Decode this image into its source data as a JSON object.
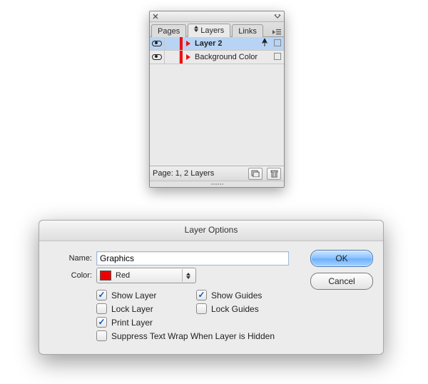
{
  "panel": {
    "tabs": [
      "Pages",
      "Layers",
      "Links"
    ],
    "active_tab": 1,
    "layers": [
      {
        "name": "Layer 2",
        "color": "#ee1111",
        "selected": true,
        "has_pen": true
      },
      {
        "name": "Background Color",
        "color": "#ee1111",
        "selected": false,
        "has_pen": false
      }
    ],
    "footer_status": "Page: 1, 2 Layers"
  },
  "dialog": {
    "title": "Layer Options",
    "name_label": "Name:",
    "name_value": "Graphics",
    "color_label": "Color:",
    "color_value": "Red",
    "color_swatch": "#ee0000",
    "checks": {
      "show_layer": {
        "label": "Show Layer",
        "checked": true
      },
      "lock_layer": {
        "label": "Lock Layer",
        "checked": false
      },
      "print_layer": {
        "label": "Print Layer",
        "checked": true
      },
      "show_guides": {
        "label": "Show Guides",
        "checked": true
      },
      "lock_guides": {
        "label": "Lock Guides",
        "checked": false
      },
      "suppress": {
        "label": "Suppress Text Wrap When Layer is Hidden",
        "checked": false
      }
    },
    "buttons": {
      "ok": "OK",
      "cancel": "Cancel"
    }
  }
}
